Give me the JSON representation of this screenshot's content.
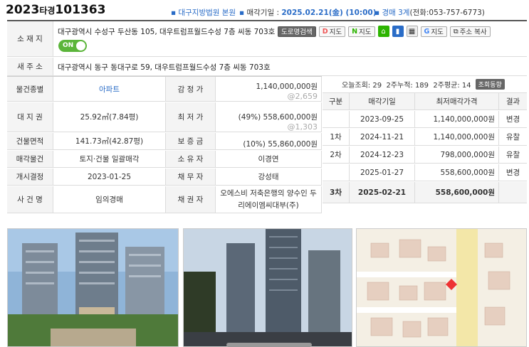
{
  "header": {
    "case_year": "2023",
    "case_type": "타경",
    "case_num": "101363",
    "court": "대구지방법원 본원",
    "sale_date_label": "매각기일 : ",
    "sale_date": "2025.02.21(金) (10:00)",
    "dept_label": "경매 3계",
    "dept_phone": "(전화:053-757-6773)"
  },
  "address": {
    "location_label": "소 재 지",
    "location": "대구광역시 수성구 두산동 105, 대우트럼프월드수성 7층 씨동 703호",
    "road_label": "새 주 소",
    "road": "대구광역시 동구 동대구로 59, 대우트럼프월드수성 7층 씨동 703호",
    "toggle": "ON",
    "buttons": {
      "road_search": "도로명검색",
      "daum_map": "지도",
      "naver_map": "지도",
      "google_map": "지도",
      "copy_addr": "주소 복사"
    }
  },
  "info": {
    "rows": [
      {
        "l1": "물건종별",
        "v1": "아파트",
        "l2": "감 정 가",
        "v2": "1,140,000,000원",
        "v2sub": "@2,659"
      },
      {
        "l1": "대 지 권",
        "v1": "25.92㎡(7.84평)",
        "l2": "최 저 가",
        "v2": "(49%) 558,600,000원",
        "v2sub": "@1,303"
      },
      {
        "l1": "건물면적",
        "v1": "141.73㎡(42.87평)",
        "l2": "보 증 금",
        "v2": "(10%) 55,860,000원",
        "v2sub": ""
      },
      {
        "l1": "매각물건",
        "v1": "토지·건물 일괄매각",
        "l2": "소 유 자",
        "v2": "이경연",
        "v2sub": ""
      },
      {
        "l1": "개시결정",
        "v1": "2023-01-25",
        "l2": "채 무 자",
        "v2": "강성태",
        "v2sub": ""
      },
      {
        "l1": "사 건 명",
        "v1": "임의경매",
        "l2": "채 권 자",
        "v2": "오에스비 저축은행의 양수인 두리에이엠씨대부(주)",
        "v2sub": ""
      }
    ]
  },
  "history": {
    "views_today": "오늘조회: 29",
    "views_2w": "2주누적: 189",
    "views_avg": "2주평균: 14",
    "views_badge": "조회동향",
    "headers": [
      "구분",
      "매각기일",
      "최저매각가격",
      "결과"
    ],
    "rows": [
      {
        "round": "",
        "date": "2023-09-25",
        "price": "1,140,000,000원",
        "result": "변경"
      },
      {
        "round": "1차",
        "date": "2024-11-21",
        "price": "1,140,000,000원",
        "result": "유찰"
      },
      {
        "round": "2차",
        "date": "2024-12-23",
        "price": "798,000,000원",
        "result": "유찰"
      },
      {
        "round": "",
        "date": "2025-01-27",
        "price": "558,600,000원",
        "result": "변경"
      },
      {
        "round": "3차",
        "date": "2025-02-21",
        "price": "558,600,000원",
        "result": ""
      }
    ]
  },
  "colors": {
    "accent": "#2a6cc7",
    "toggle_on": "#5bb53a",
    "header_bg": "#f4f4f4"
  }
}
